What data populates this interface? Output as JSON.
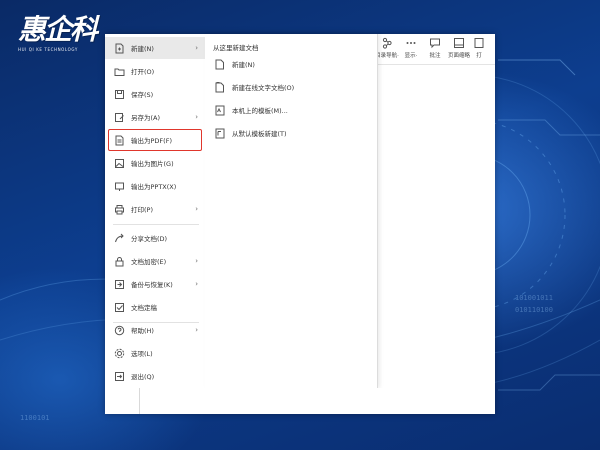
{
  "logo": {
    "text": "惠企科",
    "sub": "HUI QI KE TECHNOLOGY"
  },
  "colors": {
    "highlight": "#e0362c",
    "background": "#0b2f6e"
  },
  "ribbon": [
    {
      "label": "目录导航·",
      "icon": "navigation-icon"
    },
    {
      "label": "显示·",
      "icon": "display-icon"
    },
    {
      "label": "批注",
      "icon": "comment-icon"
    },
    {
      "label": "页面缩略",
      "icon": "thumbnail-icon"
    },
    {
      "label": "打",
      "icon": "print-icon"
    }
  ],
  "menu": {
    "items": [
      {
        "label": "新建(N)",
        "icon": "new-doc-icon",
        "arrow": true,
        "active": true
      },
      {
        "label": "打开(O)",
        "icon": "open-folder-icon"
      },
      {
        "label": "保存(S)",
        "icon": "save-icon"
      },
      {
        "label": "另存为(A)",
        "icon": "save-as-icon",
        "arrow": true
      },
      {
        "label": "输出为PDF(F)",
        "icon": "export-pdf-icon",
        "highlight": true
      },
      {
        "label": "输出为图片(G)",
        "icon": "export-image-icon"
      },
      {
        "label": "输出为PPTX(X)",
        "icon": "export-pptx-icon"
      },
      {
        "label": "打印(P)",
        "icon": "print-icon",
        "arrow": true
      },
      {
        "label": "分享文档(D)",
        "icon": "share-icon"
      },
      {
        "label": "文档加密(E)",
        "icon": "encrypt-icon",
        "arrow": true
      },
      {
        "label": "备份与恢复(K)",
        "icon": "backup-icon",
        "arrow": true
      },
      {
        "label": "文档定稿",
        "icon": "finalize-icon"
      },
      {
        "label": "帮助(H)",
        "icon": "help-icon",
        "arrow": true
      },
      {
        "label": "选项(L)",
        "icon": "options-gear-icon"
      },
      {
        "label": "退出(Q)",
        "icon": "exit-icon"
      }
    ]
  },
  "submenu": {
    "title": "从这里新建文档",
    "items": [
      {
        "label": "新建(N)",
        "icon": "blank-doc-icon"
      },
      {
        "label": "新建在线文字文档(O)",
        "icon": "online-doc-icon"
      },
      {
        "label": "本机上的模板(M)...",
        "icon": "local-template-icon"
      },
      {
        "label": "从默认模板新建(T)",
        "icon": "default-template-icon"
      }
    ]
  }
}
